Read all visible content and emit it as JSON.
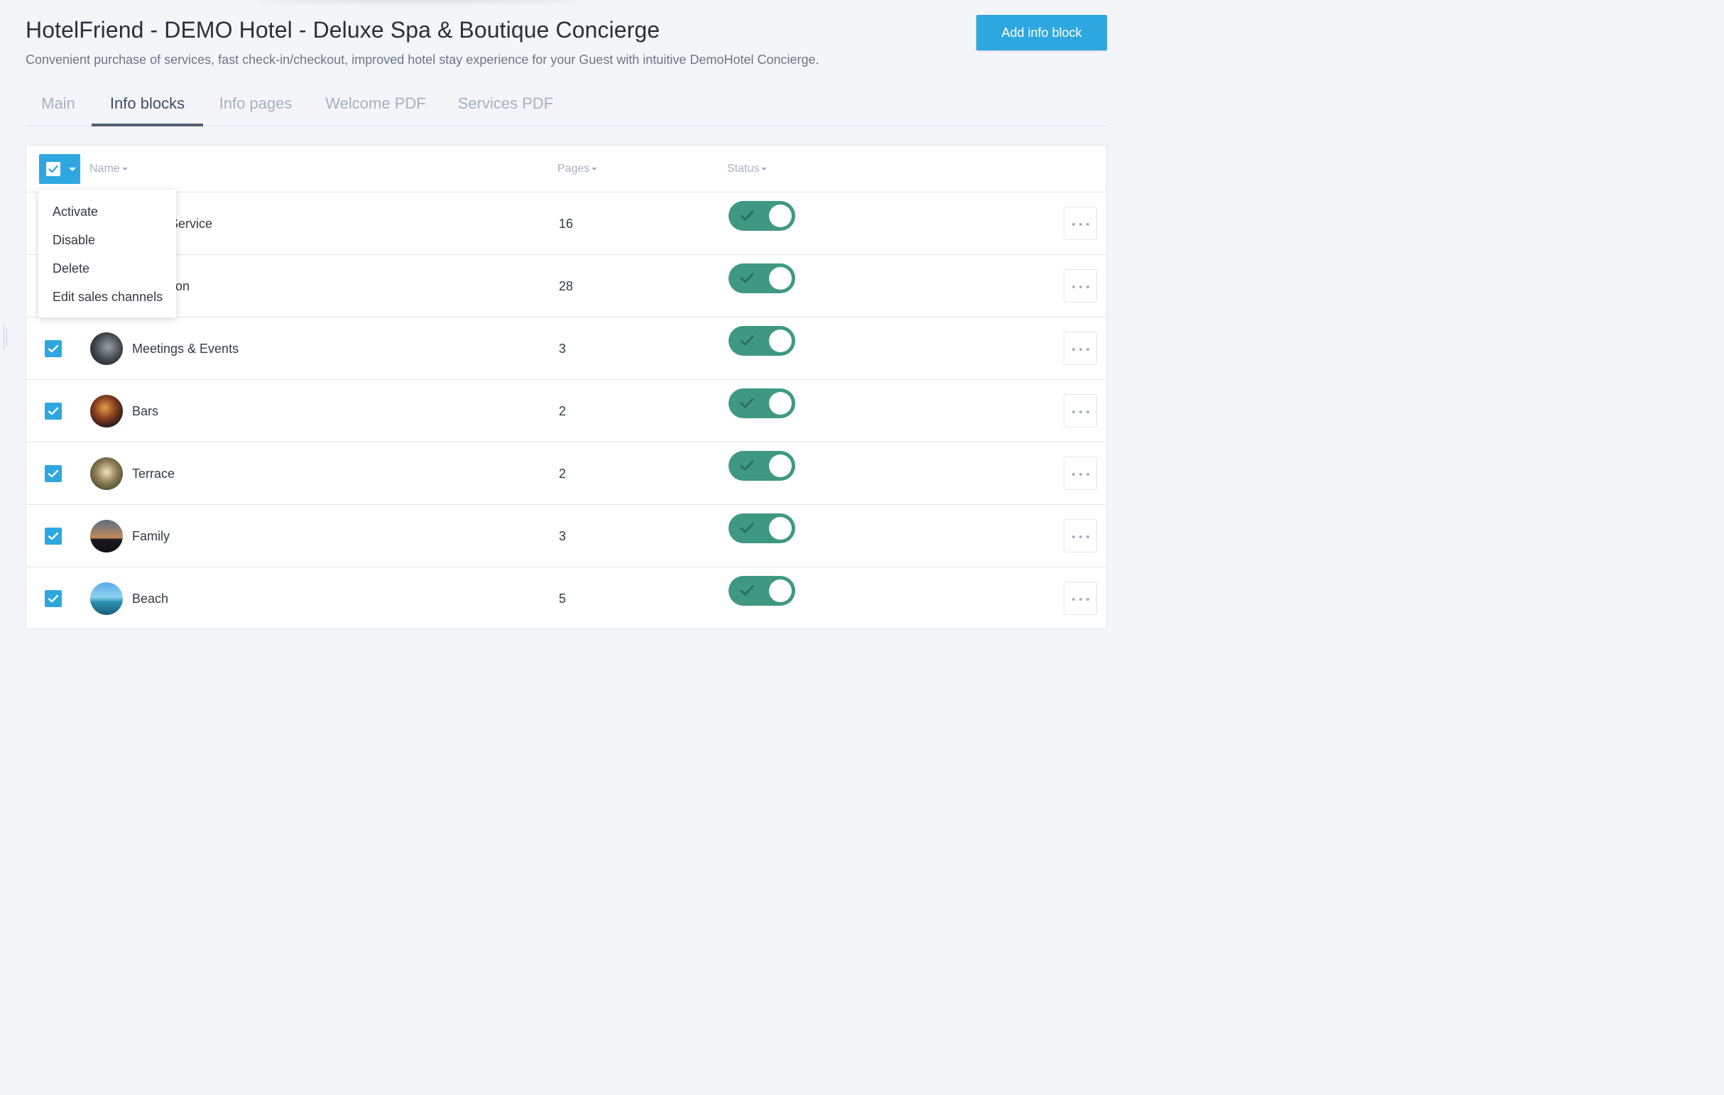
{
  "header": {
    "title": "HotelFriend - DEMO Hotel - Deluxe Spa & Boutique Concierge",
    "subtitle": "Convenient purchase of services, fast check-in/checkout, improved hotel stay experience for your Guest with intuitive DemoHotel Concierge.",
    "add_button_label": "Add info block"
  },
  "tabs": [
    {
      "label": "Main",
      "active": false
    },
    {
      "label": "Info blocks",
      "active": true
    },
    {
      "label": "Info pages",
      "active": false
    },
    {
      "label": "Welcome PDF",
      "active": false
    },
    {
      "label": "Services PDF",
      "active": false
    }
  ],
  "table": {
    "columns": {
      "name": "Name",
      "pages": "Pages",
      "status": "Status"
    },
    "rows": [
      {
        "name": "Room Service",
        "pages": "16",
        "checked": true,
        "active": true
      },
      {
        "name": "Reception",
        "pages": "28",
        "checked": true,
        "active": true
      },
      {
        "name": "Meetings & Events",
        "pages": "3",
        "checked": true,
        "active": true
      },
      {
        "name": "Bars",
        "pages": "2",
        "checked": true,
        "active": true
      },
      {
        "name": "Terrace",
        "pages": "2",
        "checked": true,
        "active": true
      },
      {
        "name": "Family",
        "pages": "3",
        "checked": true,
        "active": true
      },
      {
        "name": "Beach",
        "pages": "5",
        "checked": true,
        "active": true
      }
    ]
  },
  "bulk_menu": {
    "items": [
      "Activate",
      "Disable",
      "Delete",
      "Edit sales channels"
    ]
  },
  "colors": {
    "accent": "#2ea7e0",
    "toggle_on": "#3f9882",
    "tab_active": "#3e4e66",
    "tab_inactive": "#a6b1c1"
  },
  "icons": {
    "checkbox": "checkmark-icon",
    "more": "ellipsis-icon",
    "sort": "caret-down-icon",
    "toggle": "check-icon"
  }
}
